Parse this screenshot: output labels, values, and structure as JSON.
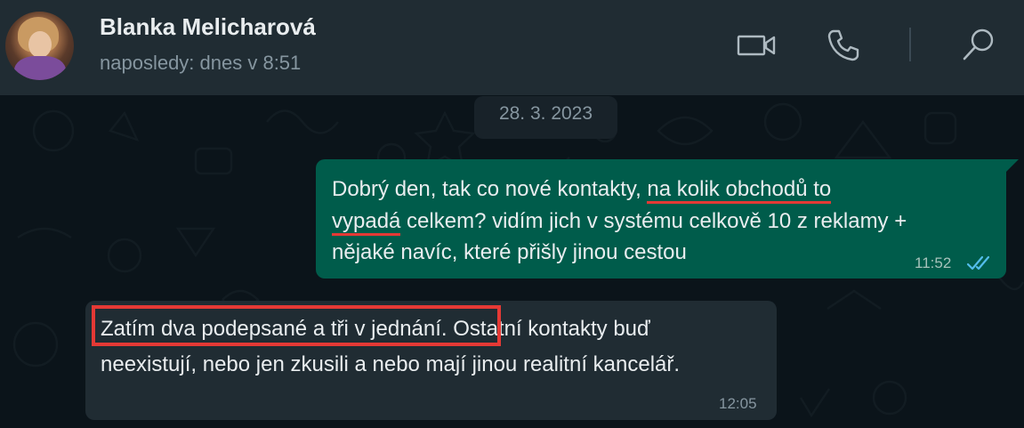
{
  "header": {
    "contact_name": "Blanka Melicharová",
    "status": "naposledy: dnes v 8:51",
    "icons": [
      "video-call-icon",
      "voice-call-icon",
      "search-icon"
    ]
  },
  "chat": {
    "date_chip": "28. 3. 2023",
    "messages": [
      {
        "direction": "outgoing",
        "lines": [
          [
            "Dobrý den, tak co nové kontakty, ",
            "na kolik obchodů to"
          ],
          [
            "vypadá",
            " celkem? vidím jich v systému celkově 10 z reklamy +"
          ],
          [
            "nějaké navíc, které přišly jinou cestou"
          ]
        ],
        "time": "11:52",
        "status_icon": "double-check-read-icon",
        "underline_color": "#e53935"
      },
      {
        "direction": "incoming",
        "lines": [
          [
            "Zatím dva podepsané a tři v jednání.",
            " Ostatní kontakty buď"
          ],
          [
            "neexistují, nebo jen zkusili a nebo mají jinou realitní kancelář."
          ]
        ],
        "time": "12:05",
        "highlight_color": "#e53935"
      }
    ]
  },
  "colors": {
    "header_bg": "#202c33",
    "chat_bg": "#0b141a",
    "outgoing_bubble": "#005c4b",
    "incoming_bubble": "#202c33",
    "read_check": "#53bdeb"
  }
}
